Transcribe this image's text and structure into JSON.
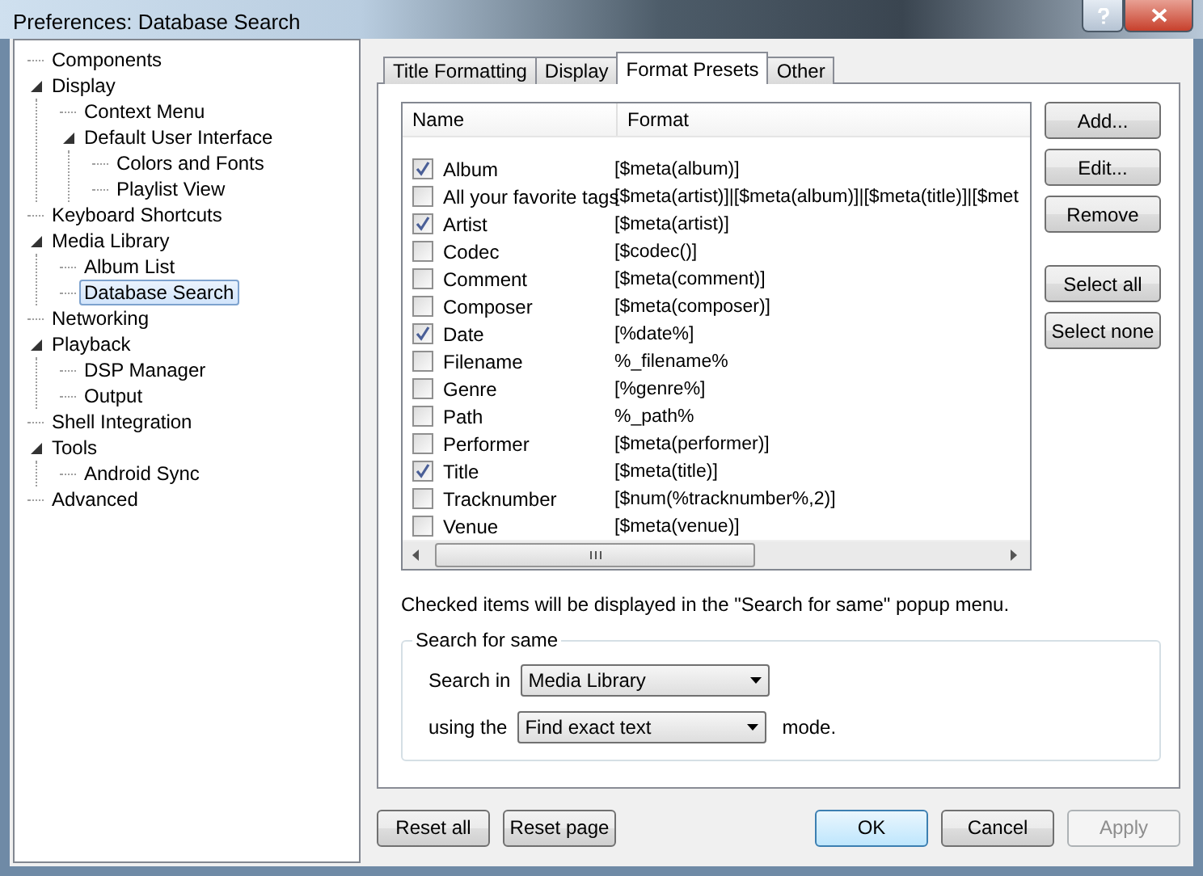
{
  "window": {
    "title": "Preferences: Database Search"
  },
  "tree": [
    {
      "label": "Components",
      "selected": false
    },
    {
      "label": "Display",
      "expanded": true,
      "selected": false,
      "children": [
        {
          "label": "Context Menu",
          "selected": false
        },
        {
          "label": "Default User Interface",
          "expanded": true,
          "selected": false,
          "children": [
            {
              "label": "Colors and Fonts",
              "selected": false
            },
            {
              "label": "Playlist View",
              "selected": false
            }
          ]
        }
      ]
    },
    {
      "label": "Keyboard Shortcuts",
      "selected": false
    },
    {
      "label": "Media Library",
      "expanded": true,
      "selected": false,
      "children": [
        {
          "label": "Album List",
          "selected": false
        },
        {
          "label": "Database Search",
          "selected": true
        }
      ]
    },
    {
      "label": "Networking",
      "selected": false
    },
    {
      "label": "Playback",
      "expanded": true,
      "selected": false,
      "children": [
        {
          "label": "DSP Manager",
          "selected": false
        },
        {
          "label": "Output",
          "selected": false
        }
      ]
    },
    {
      "label": "Shell Integration",
      "selected": false
    },
    {
      "label": "Tools",
      "expanded": true,
      "selected": false,
      "children": [
        {
          "label": "Android Sync",
          "selected": false
        }
      ]
    },
    {
      "label": "Advanced",
      "selected": false
    }
  ],
  "tabs": [
    {
      "label": "Title Formatting",
      "selected": false
    },
    {
      "label": "Display",
      "selected": false
    },
    {
      "label": "Format Presets",
      "selected": true
    },
    {
      "label": "Other",
      "selected": false
    }
  ],
  "list": {
    "columns": [
      "Name",
      "Format"
    ],
    "rows": [
      {
        "checked": true,
        "name": "Album",
        "format": "[$meta(album)]"
      },
      {
        "checked": false,
        "name": "All your favorite tags",
        "format": "[$meta(artist)]|[$meta(album)]|[$meta(title)]|[$met"
      },
      {
        "checked": true,
        "name": "Artist",
        "format": "[$meta(artist)]"
      },
      {
        "checked": false,
        "name": "Codec",
        "format": "[$codec()]"
      },
      {
        "checked": false,
        "name": "Comment",
        "format": "[$meta(comment)]"
      },
      {
        "checked": false,
        "name": "Composer",
        "format": "[$meta(composer)]"
      },
      {
        "checked": true,
        "name": "Date",
        "format": "[%date%]"
      },
      {
        "checked": false,
        "name": "Filename",
        "format": "%_filename%"
      },
      {
        "checked": false,
        "name": "Genre",
        "format": "[%genre%]"
      },
      {
        "checked": false,
        "name": "Path",
        "format": "%_path%"
      },
      {
        "checked": false,
        "name": "Performer",
        "format": "[$meta(performer)]"
      },
      {
        "checked": true,
        "name": "Title",
        "format": "[$meta(title)]"
      },
      {
        "checked": false,
        "name": "Tracknumber",
        "format": "[$num(%tracknumber%,2)]"
      },
      {
        "checked": false,
        "name": "Venue",
        "format": "[$meta(venue)]"
      }
    ]
  },
  "side_buttons": [
    {
      "label": "Add..."
    },
    {
      "label": "Edit..."
    },
    {
      "label": "Remove"
    },
    {
      "label": "Select all"
    },
    {
      "label": "Select none"
    }
  ],
  "note": "Checked items will be displayed in the \"Search for same\" popup menu.",
  "group": {
    "title": "Search for same",
    "search_in_label": "Search in",
    "search_in_value": "Media Library",
    "using_label": "using the",
    "using_value": "Find exact text",
    "mode_label": "mode."
  },
  "footer_left": [
    {
      "label": "Reset all",
      "disabled": false
    },
    {
      "label": "Reset page",
      "disabled": false
    }
  ],
  "footer_right": [
    {
      "label": "OK",
      "default": true,
      "disabled": false
    },
    {
      "label": "Cancel",
      "default": false,
      "disabled": false
    },
    {
      "label": "Apply",
      "default": false,
      "disabled": true
    }
  ]
}
